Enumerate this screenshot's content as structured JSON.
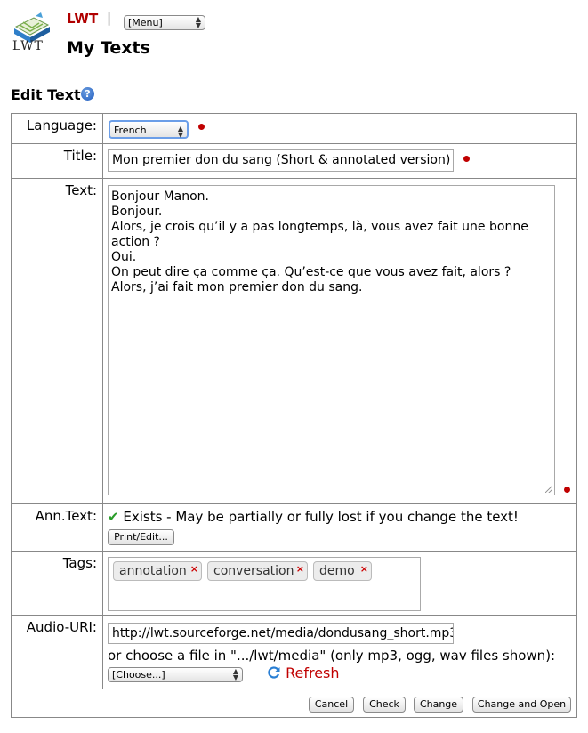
{
  "header": {
    "logo_text": "LWT",
    "brand": "LWT",
    "separator": "|",
    "menu_select": "[Menu]",
    "page_title": "My Texts"
  },
  "section": {
    "title": "Edit Text",
    "help_icon": "?"
  },
  "form": {
    "language": {
      "label": "Language:",
      "value": "French"
    },
    "title": {
      "label": "Title:",
      "value": "Mon premier don du sang (Short & annotated version)"
    },
    "text": {
      "label": "Text:",
      "lines": [
        "Bonjour Manon.",
        "Bonjour.",
        "Alors, je crois qu’il y a pas longtemps, là, vous avez fait une bonne",
        "action ?",
        "Oui.",
        "On peut dire ça comme ça. Qu’est-ce que vous avez fait, alors ?",
        "Alors, j’ai fait mon premier don du sang."
      ]
    },
    "ann_text": {
      "label": "Ann.Text:",
      "check_icon": "✔",
      "status": "Exists - May be partially or fully lost if you change the text!",
      "print_edit_button": "Print/Edit..."
    },
    "tags": {
      "label": "Tags:",
      "items": [
        "annotation",
        "conversation",
        "demo"
      ],
      "remove_glyph": "×"
    },
    "audio": {
      "label": "Audio-URI:",
      "value": "http://lwt.sourceforge.net/media/dondusang_short.mp3",
      "choose_text": "or choose a file in \".../lwt/media\" (only mp3, ogg, wav files shown):",
      "choose_select": "[Choose...]",
      "refresh_label": "Refresh"
    },
    "buttons": {
      "cancel": "Cancel",
      "check": "Check",
      "change": "Change",
      "change_open": "Change and Open"
    }
  },
  "colors": {
    "brand": "#b00000",
    "required_dot": "#c00000",
    "check": "#2a9d2a",
    "refresh": "#c00000"
  }
}
